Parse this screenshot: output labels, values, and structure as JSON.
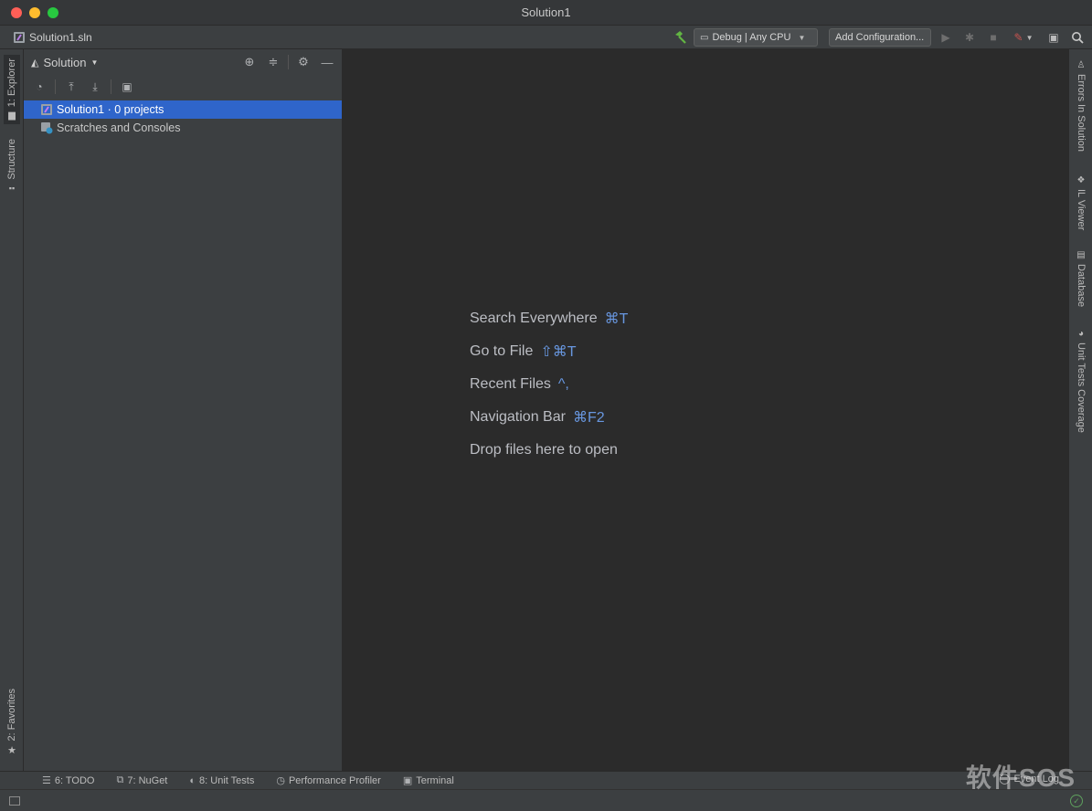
{
  "window": {
    "title": "Solution1"
  },
  "navbar": {
    "breadcrumb": "Solution1.sln",
    "config_label": "Debug | Any CPU",
    "add_config_label": "Add Configuration..."
  },
  "left_stripe": {
    "explorer_label": "1: Explorer",
    "structure_label": "Structure",
    "favorites_label": "2: Favorites"
  },
  "right_stripe": {
    "errors_label": "Errors In Solution",
    "il_viewer_label": "IL Viewer",
    "database_label": "Database",
    "coverage_label": "Unit Tests Coverage"
  },
  "explorer": {
    "title": "Solution",
    "tree": [
      {
        "label": "Solution1 · 0 projects",
        "selected": true
      },
      {
        "label": "Scratches and Consoles",
        "selected": false
      }
    ]
  },
  "editor": {
    "hints": [
      {
        "label": "Search Everywhere",
        "shortcut": "⌘T"
      },
      {
        "label": "Go to File",
        "shortcut": "⇧⌘T"
      },
      {
        "label": "Recent Files",
        "shortcut": "^,"
      },
      {
        "label": "Navigation Bar",
        "shortcut": "⌘F2"
      },
      {
        "label": "Drop files here to open",
        "shortcut": ""
      }
    ]
  },
  "bottom_tools": {
    "todo": "6: TODO",
    "nuget": "7: NuGet",
    "unit_tests": "8: Unit Tests",
    "profiler": "Performance Profiler",
    "terminal": "Terminal",
    "event_log": "Event Log"
  },
  "watermark": "软件SOS",
  "colors": {
    "selection": "#2f65ca",
    "shortcut": "#6897e0",
    "panel_bg": "#3c3f41",
    "editor_bg": "#2b2b2b"
  }
}
